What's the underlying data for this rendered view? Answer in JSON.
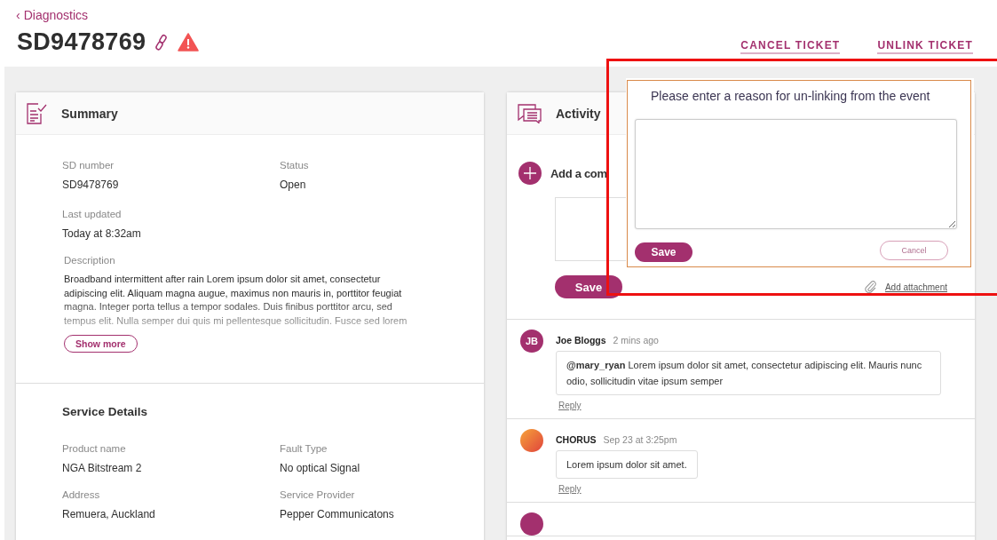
{
  "breadcrumb": {
    "icon": "‹",
    "label": "Diagnostics"
  },
  "title": "SD9478769",
  "title_badges": {
    "linked": true,
    "warning": true
  },
  "actions": [
    {
      "label": "CANCEL TICKET"
    },
    {
      "label": "UNLINK TICKET"
    }
  ],
  "summary": {
    "title": "Summary",
    "fields": [
      {
        "label": "SD number",
        "value": "SD9478769"
      },
      {
        "label": "Status",
        "value": "Open"
      },
      {
        "label": "Last updated",
        "value": "Today at 8:32am"
      }
    ],
    "description": {
      "label": "Description",
      "text": "Broadband intermittent after rain Lorem ipsum dolor sit amet, consectetur adipiscing elit. Aliquam magna augue, maximus non mauris in, porttitor feugiat magna. Integer porta tellus a tempor sodales. Duis finibus porttitor arcu, sed tempus elit. Nulla semper dui quis mi pellentesque sollicitudin. Fusce sed lorem",
      "button": "Show more"
    }
  },
  "service_details": {
    "title": "Service Details",
    "fields": [
      {
        "label": "Product name",
        "value": "NGA Bitstream 2"
      },
      {
        "label": "Fault Type",
        "value": "No optical Signal"
      },
      {
        "label": "Address",
        "value": "Remuera, Auckland"
      },
      {
        "label": "Service Provider",
        "value": "Pepper Communicatons"
      }
    ]
  },
  "activity": {
    "title": "Activity",
    "add_comment": "Add a com",
    "save": "Save",
    "attachment": "Add attachment",
    "comments": [
      {
        "avatar": {
          "kind": "initials",
          "text": "JB"
        },
        "author": "Joe Bloggs",
        "time": "2 mins ago",
        "body": "**@mary_ryan**  Lorem ipsum dolor sit amet, consectetur adipiscing elit. Mauris nunc odio, sollicitudin vitae ipsum semper",
        "reply": "Reply"
      },
      {
        "avatar": {
          "kind": "gradient"
        },
        "author": "CHORUS",
        "time": "Sep 23 at 3:25pm",
        "body": "Lorem ipsum dolor sit amet.",
        "reply": "Reply"
      },
      {
        "avatar": {
          "kind": "initials"
        }
      }
    ]
  },
  "unlink_dialog": {
    "prompt": "Please enter a reason for un-linking from the event",
    "save": "Save",
    "cancel": "Cancel"
  }
}
